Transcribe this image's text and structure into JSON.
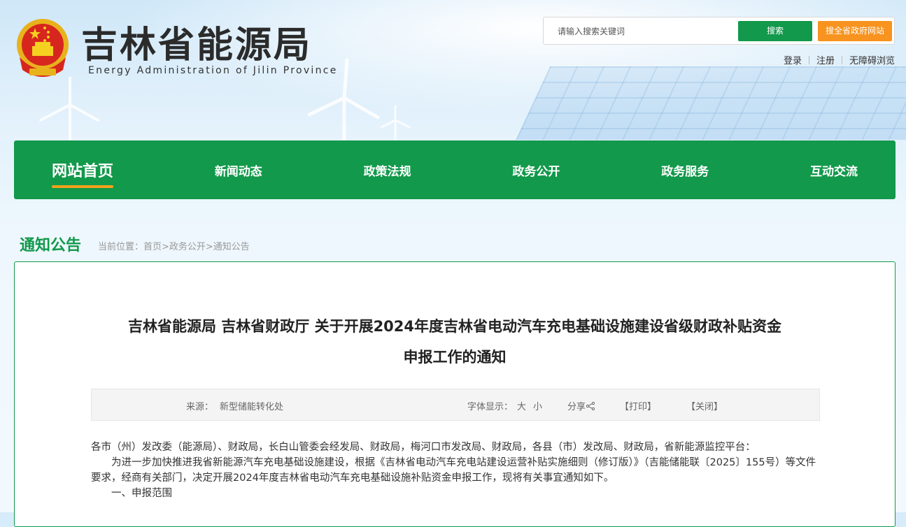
{
  "header": {
    "site_title": "吉林省能源局",
    "site_subtitle": "Energy Administration of Jilin Province",
    "search_placeholder": "请输入搜索关键词",
    "search_label": "搜索",
    "search_all_label": "搜全省政府网站",
    "links": [
      "登录",
      "注册",
      "无障碍浏览"
    ]
  },
  "nav": {
    "items": [
      "网站首页",
      "新闻动态",
      "政策法规",
      "政务公开",
      "政务服务",
      "互动交流"
    ],
    "active_index": 0
  },
  "section": {
    "title": "通知公告",
    "breadcrumb": "当前位置：首页>政务公开>通知公告"
  },
  "article": {
    "title_line1": "吉林省能源局 吉林省财政厅 关于开展2024年度吉林省电动汽车充电基础设施建设省级财政补贴资金",
    "title_line2": "申报工作的通知",
    "meta": {
      "source_label": "来源：",
      "source_value": "新型储能转化处",
      "font_label": "字体显示：",
      "font_large": "大",
      "font_small": "小",
      "share": "分享",
      "print": "【打印】",
      "close": "【关闭】"
    },
    "paragraphs": [
      "各市（州）发改委（能源局）、财政局，长白山管委会经发局、财政局，梅河口市发改局、财政局，各县（市）发改局、财政局，省新能源监控平台：",
      "为进一步加快推进我省新能源汽车充电基础设施建设，根据《吉林省电动汽车充电站建设运营补贴实施细则（修订版）》（吉能储能联〔2025〕155号）等文件要求，经商有关部门，决定开展2024年度吉林省电动汽车充电基础设施补贴资金申报工作，现将有关事宜通知如下。",
      "一、申报范围"
    ]
  },
  "colors": {
    "primary_green": "#12994b",
    "accent_orange": "#f7931e"
  }
}
